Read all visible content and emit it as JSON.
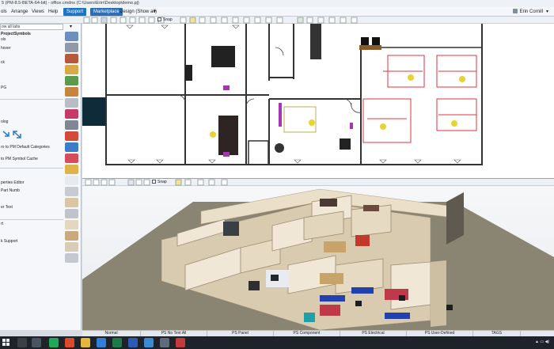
{
  "window": {
    "title": "5 (PM-8.5-BETA-64-bit) - office.cmdnx (C:\\Users\\Erin\\Desktop\\demo.pj)"
  },
  "menu": {
    "items": [
      "ols",
      "Arrange",
      "Views",
      "Help"
    ],
    "support_label": "Support",
    "marketplace_label": "Marketplace",
    "design_label": "Design (Show all)",
    "user_name": "Erin Cornill"
  },
  "sidebar": {
    "filter_value": "ow all labs",
    "project_symbols": "ProjectSymbols",
    "labels": [
      "ols",
      "hover",
      "ck",
      "PG",
      "olog",
      "ro to PM Default Categories",
      "to PM Symbol Cache",
      "perties Editor",
      "Part Numb",
      "er Text",
      "rt",
      "k Support"
    ]
  },
  "plan_toolbar": {
    "snap_label": "Snap"
  },
  "view3d_toolbar": {
    "snap_label": "Snap"
  },
  "bottom_tabs": [
    "Normal",
    "PS No Text All",
    "PS Panel",
    "PS Component",
    "PS Electrical",
    "PS User-Defined",
    "TAGS"
  ],
  "colors": {
    "accent": "#1d73c4",
    "marketplace": "#2e6fb3",
    "floor_carpet": "#8a8473",
    "wall": "#f0e7d6"
  }
}
